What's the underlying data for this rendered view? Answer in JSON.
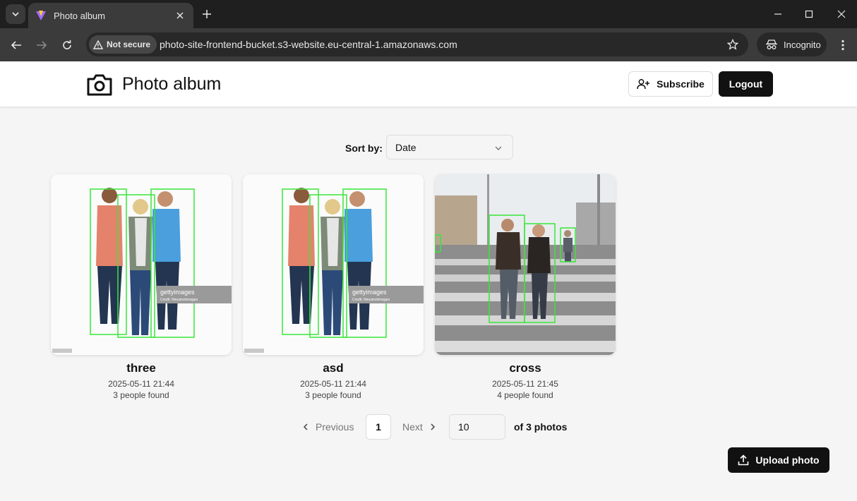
{
  "browser": {
    "tab_title": "Photo album",
    "security_label": "Not secure",
    "url": "photo-site-frontend-bucket.s3-website.eu-central-1.amazonaws.com",
    "incognito_label": "Incognito"
  },
  "header": {
    "title": "Photo album",
    "subscribe_label": "Subscribe",
    "logout_label": "Logout"
  },
  "sort": {
    "label": "Sort by:",
    "value": "Date"
  },
  "photos": [
    {
      "title": "three",
      "date": "2025-05-11 21:44",
      "people": "3 people found",
      "watermark": "gettyimages",
      "credit": "Credit: Neustockimages"
    },
    {
      "title": "asd",
      "date": "2025-05-11 21:44",
      "people": "3 people found",
      "watermark": "gettyimages",
      "credit": "Credit: Neustockimages"
    },
    {
      "title": "cross",
      "date": "2025-05-11 21:45",
      "people": "4 people found"
    }
  ],
  "pagination": {
    "previous_label": "Previous",
    "current_page": "1",
    "next_label": "Next",
    "page_size": "10",
    "total_label": "of 3 photos"
  },
  "upload": {
    "label": "Upload photo"
  },
  "colors": {
    "primary": "#111111",
    "background": "#f5f5f5",
    "detection_box": "#39e639"
  }
}
